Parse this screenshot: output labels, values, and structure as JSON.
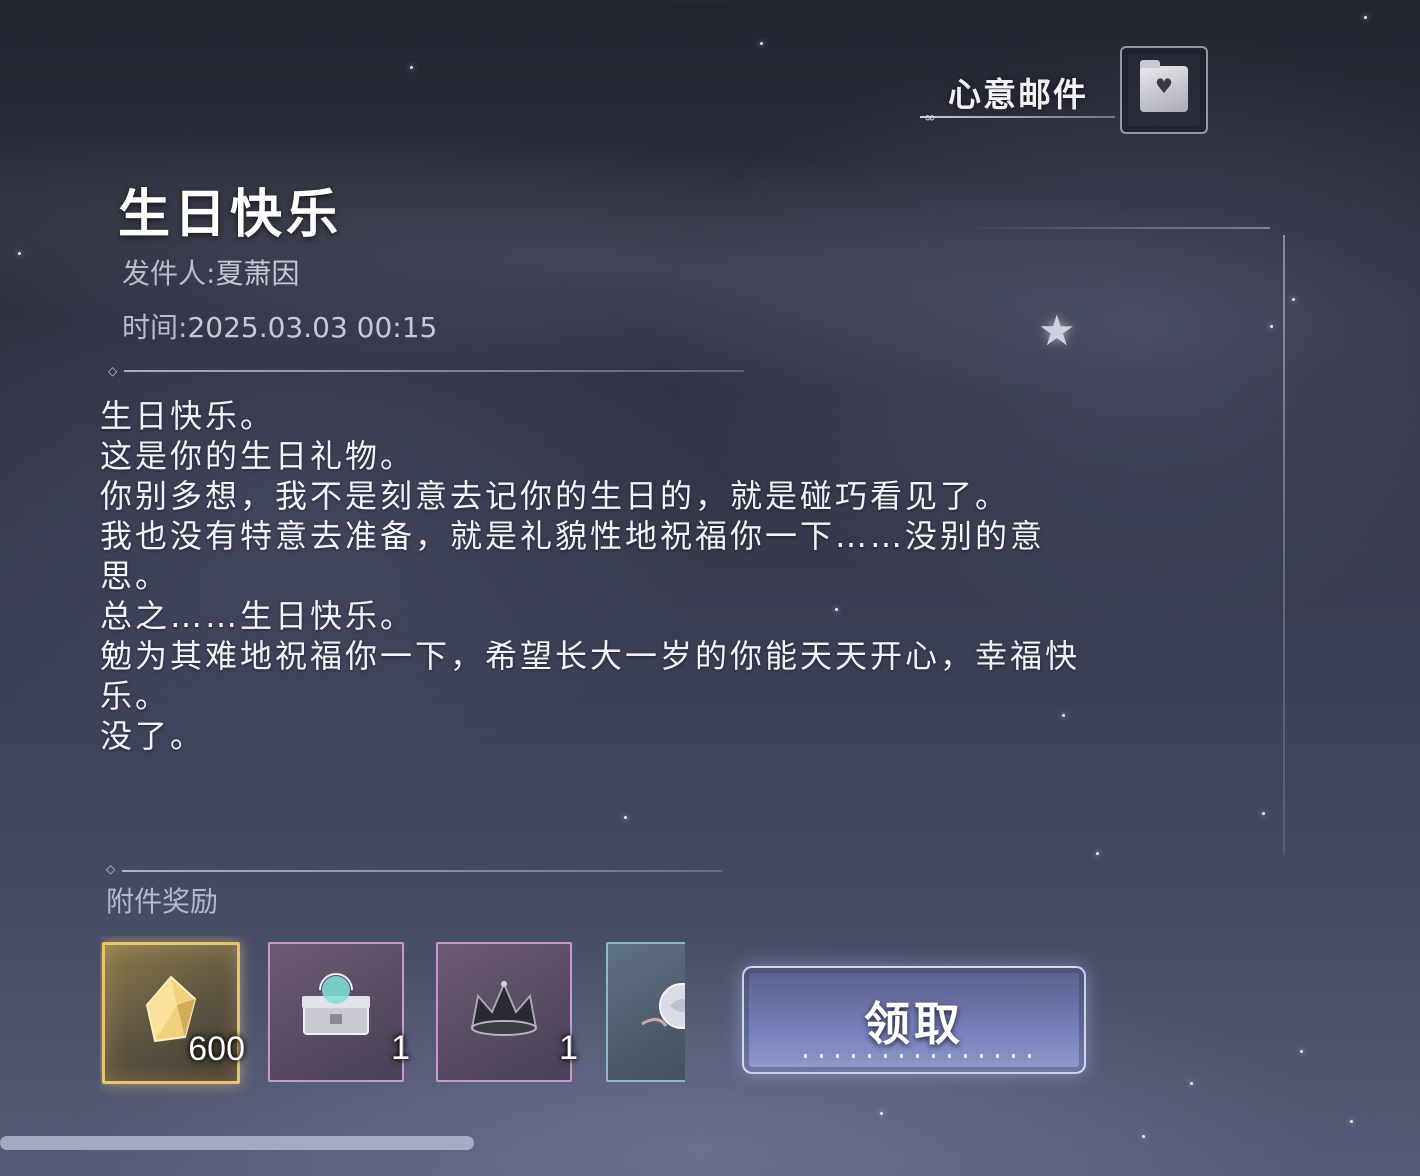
{
  "header": {
    "title": "心意邮件",
    "folder_icon": "heart-folder-icon"
  },
  "mail": {
    "title": "生日快乐",
    "sender_label": "发件人:",
    "sender": "夏萧因",
    "time_label": "时间:",
    "time": "2025.03.03 00:15",
    "body": [
      "生日快乐。",
      "这是你的生日礼物。",
      "你别多想，我不是刻意去记你的生日的，就是碰巧看见了。",
      "我也没有特意去准备，就是礼貌性地祝福你一下……没别的意思。",
      "总之……生日快乐。",
      "勉为其难地祝福你一下，希望长大一岁的你能天天开心，幸福快乐。",
      "没了。"
    ]
  },
  "attachments": {
    "label": "附件奖励",
    "items": [
      {
        "icon": "gold-crystal-icon",
        "count": "600",
        "rarity_color": "#e8c56a"
      },
      {
        "icon": "silver-chest-icon",
        "count": "1",
        "rarity_color": "#c79bc8"
      },
      {
        "icon": "dark-crown-icon",
        "count": "1",
        "rarity_color": "#c79bc8"
      },
      {
        "icon": "white-rose-icon",
        "count": "",
        "rarity_color": "#8fb7c8"
      }
    ]
  },
  "claim_button": {
    "label": "领取"
  },
  "colors": {
    "accent": "#9aa2dc",
    "text": "#f2f3f8",
    "muted": "#b9bccb"
  }
}
